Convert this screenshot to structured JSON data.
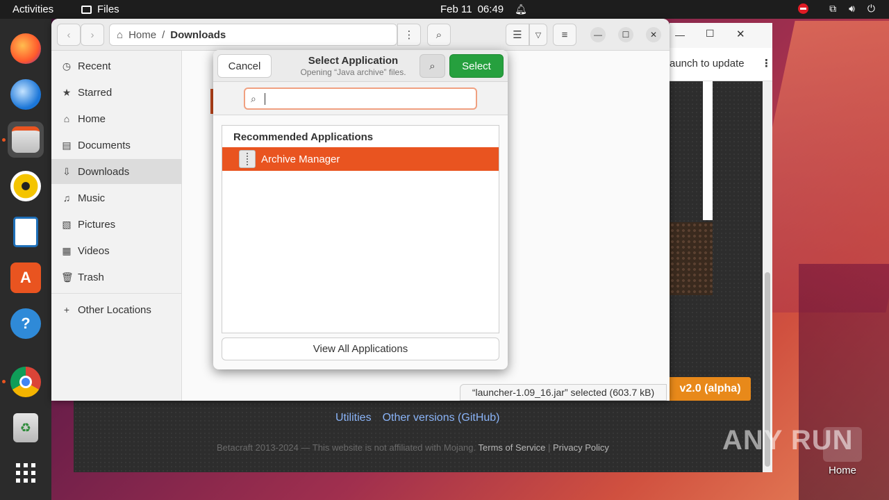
{
  "topbar": {
    "activities": "Activities",
    "app_menu": "Files",
    "date": "Feb 11",
    "time": "06:49"
  },
  "dock": {
    "items": [
      "Firefox",
      "Thunderbird",
      "Files",
      "Rhythmbox",
      "LibreOffice Writer",
      "Ubuntu Software",
      "Help",
      "Google Chrome",
      "Trash",
      "Show Applications"
    ]
  },
  "browser": {
    "urlbar_text": "aunch to update",
    "version_button": "v2.0 (alpha)",
    "links": [
      "Utilities",
      "Other versions (GitHub)"
    ],
    "footer_text": "Betacraft 2013-2024 — This website is not affiliated with Mojang.",
    "footer_tos": "Terms of Service",
    "footer_sep": "|",
    "footer_privacy": "Privacy Policy"
  },
  "files": {
    "path": {
      "home": "Home",
      "sep": "/",
      "current": "Downloads"
    },
    "sidebar": [
      {
        "label": "Recent",
        "icon": "clock-icon",
        "glyph": "◷"
      },
      {
        "label": "Starred",
        "icon": "star-icon",
        "glyph": "★"
      },
      {
        "label": "Home",
        "icon": "home-icon",
        "glyph": "⌂"
      },
      {
        "label": "Documents",
        "icon": "document-icon",
        "glyph": "▤"
      },
      {
        "label": "Downloads",
        "icon": "download-icon",
        "glyph": "⇩"
      },
      {
        "label": "Music",
        "icon": "music-icon",
        "glyph": "♫"
      },
      {
        "label": "Pictures",
        "icon": "picture-icon",
        "glyph": "▧"
      },
      {
        "label": "Videos",
        "icon": "video-icon",
        "glyph": "▦"
      },
      {
        "label": "Trash",
        "icon": "trash-icon",
        "glyph": "🗑"
      }
    ],
    "other_locations": "Other Locations",
    "status": "“launcher-1.09_16.jar” selected  (603.7 kB)"
  },
  "dialog": {
    "cancel": "Cancel",
    "title": "Select Application",
    "subtitle": "Opening “Java archive” files.",
    "select": "Select",
    "search_value": "",
    "list_header": "Recommended Applications",
    "apps": [
      "Archive Manager"
    ],
    "view_all": "View All Applications"
  },
  "desktop": {
    "home_label": "Home",
    "watermark": "ANY RUN"
  },
  "colors": {
    "accent": "#e95420",
    "select_green": "#26a03e",
    "topbar": "#1d1d1d",
    "dock": "#2b2b2b"
  }
}
